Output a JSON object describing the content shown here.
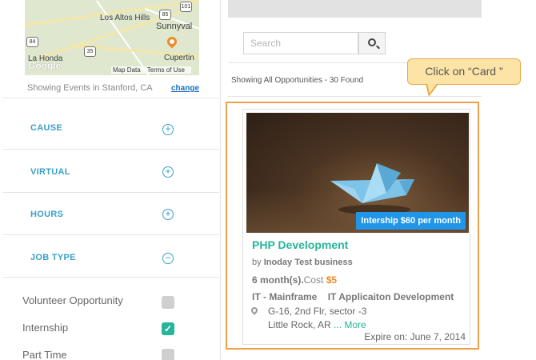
{
  "map": {
    "labels": [
      "Los Altos Hills",
      "Sunnyval",
      "La Honda",
      "Cupertin"
    ],
    "shields": [
      "101",
      "85",
      "35",
      "84"
    ],
    "google_logo": "Google",
    "footer": [
      "Map Data",
      "Terms of Use"
    ]
  },
  "location": {
    "showing_text": "Showing Events in Stanford, CA",
    "change_label": "change"
  },
  "filters": [
    {
      "label": "CAUSE",
      "icon": "plus-circle-icon",
      "state": "collapsed"
    },
    {
      "label": "VIRTUAL",
      "icon": "plus-circle-icon",
      "state": "collapsed"
    },
    {
      "label": "HOURS",
      "icon": "plus-circle-icon",
      "state": "collapsed"
    },
    {
      "label": "JOB TYPE",
      "icon": "minus-circle-icon",
      "state": "expanded"
    }
  ],
  "job_types": [
    {
      "label": "Volunteer Opportunity",
      "checked": false
    },
    {
      "label": "Internship",
      "checked": true
    },
    {
      "label": "Part Time",
      "checked": false
    }
  ],
  "search": {
    "placeholder": "Search",
    "value": ""
  },
  "results": {
    "summary": "Showing All Opportunities - 30 Found"
  },
  "callout": {
    "text": "Click on “Card ”"
  },
  "card": {
    "badge": "Intership $60 per month",
    "title": "PHP Development",
    "by_prefix": "by",
    "org": "Inoday Test business",
    "duration": "6 month(s).",
    "cost_label": "Cost",
    "cost_value": "$5",
    "category1": "IT - Mainframe",
    "category2": "IT Applicaiton Development",
    "address_line1": "G-16, 2nd Flr, sector -3",
    "address_line2": "Little Rock, AR",
    "more_label": "... More",
    "expire": "Expire on: June 7, 2014"
  },
  "colors": {
    "accent_teal": "#26b59a",
    "filter_blue": "#3aa0c8",
    "cost_orange": "#f08a24",
    "badge_blue": "#2196e8",
    "highlight_orange": "#f0a04b",
    "callout_fill": "#fde4a6"
  }
}
